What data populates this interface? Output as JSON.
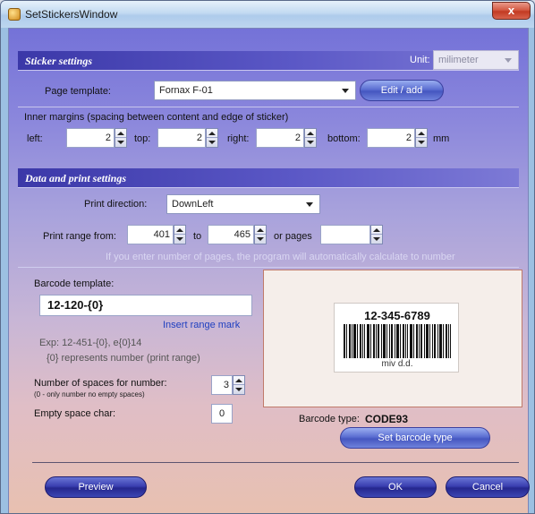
{
  "window": {
    "title": "SetStickersWindow",
    "close_glyph": "x"
  },
  "sticker_settings": {
    "header": "Sticker settings",
    "unit_label": "Unit:",
    "unit_value": "milimeter",
    "page_template_label": "Page template:",
    "page_template_value": "Fornax F-01",
    "edit_add_label": "Edit / add",
    "margins_caption": "Inner margins (spacing between content and edge of sticker)",
    "left_label": "left:",
    "left_value": "2",
    "top_label": "top:",
    "top_value": "2",
    "right_label": "right:",
    "right_value": "2",
    "bottom_label": "bottom:",
    "bottom_value": "2",
    "mm_label": "mm"
  },
  "data_print": {
    "header": "Data and print settings",
    "print_direction_label": "Print direction:",
    "print_direction_value": "DownLeft",
    "print_range_label": "Print range from:",
    "range_from": "401",
    "to_label": "to",
    "range_to": "465",
    "or_pages_label": "or pages",
    "pages_value": "",
    "pages_hint": "If you enter number of pages, the program will automatically calculate to number",
    "barcode_template_label": "Barcode template:",
    "barcode_template_value": "12-120-{0}",
    "insert_range_mark": "Insert range mark",
    "exp_line1": "Exp: 12-451-{0}, e{0}14",
    "exp_line2": "{0} represents number (print range)",
    "spaces_label": "Number of spaces for number:",
    "spaces_hint": "(0 - only number no empty spaces)",
    "spaces_value": "3",
    "empty_char_label": "Empty space char:",
    "empty_char_value": "0",
    "barcode_type_label": "Barcode type:",
    "barcode_type_value": "CODE93",
    "set_barcode_type_label": "Set barcode type",
    "preview_barcode_number": "12-345-6789",
    "preview_barcode_caption": "miv d.d."
  },
  "footer": {
    "preview_label": "Preview",
    "ok_label": "OK",
    "cancel_label": "Cancel"
  }
}
